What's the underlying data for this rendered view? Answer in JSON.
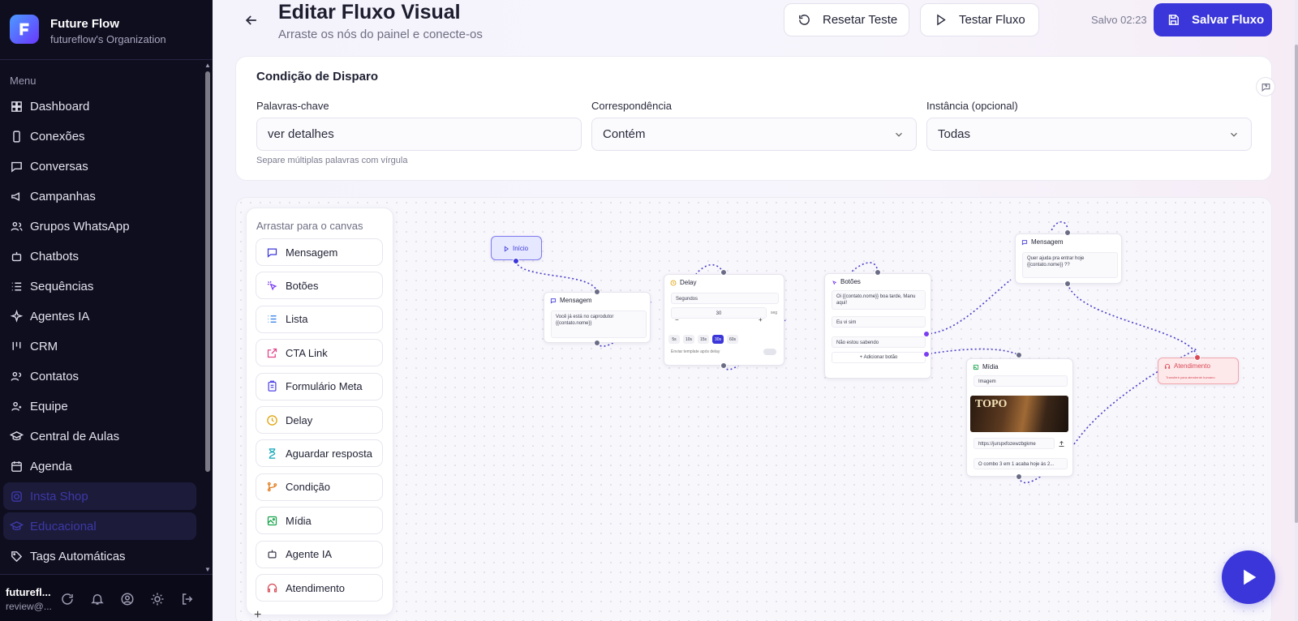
{
  "sidebar": {
    "brand_name": "Future Flow",
    "brand_org": "futureflow's Organization",
    "menu_title": "Menu",
    "items": [
      {
        "label": "Dashboard",
        "icon": "dashboard-icon"
      },
      {
        "label": "Conexões",
        "icon": "phone-icon"
      },
      {
        "label": "Conversas",
        "icon": "chat-icon"
      },
      {
        "label": "Campanhas",
        "icon": "megaphone-icon"
      },
      {
        "label": "Grupos WhatsApp",
        "icon": "users-icon"
      },
      {
        "label": "Chatbots",
        "icon": "bot-icon"
      },
      {
        "label": "Sequências",
        "icon": "list-icon"
      },
      {
        "label": "Agentes IA",
        "icon": "sparkle-icon"
      },
      {
        "label": "CRM",
        "icon": "kanban-icon"
      },
      {
        "label": "Contatos",
        "icon": "contacts-icon"
      },
      {
        "label": "Equipe",
        "icon": "team-icon"
      },
      {
        "label": "Central de Aulas",
        "icon": "graduation-icon"
      },
      {
        "label": "Agenda",
        "icon": "calendar-icon"
      },
      {
        "label": "Insta Shop",
        "icon": "instagram-icon"
      },
      {
        "label": "Educacional",
        "icon": "education-icon"
      },
      {
        "label": "Tags Automáticas",
        "icon": "tag-icon"
      }
    ],
    "user_name": "futurefl...",
    "user_email": "review@..."
  },
  "header": {
    "title": "Editar Fluxo Visual",
    "subtitle": "Arraste os nós do painel e conecte-os",
    "reset_label": "Resetar Teste",
    "test_label": "Testar Fluxo",
    "saved_text": "Salvo 02:23",
    "save_label": "Salvar Fluxo"
  },
  "trigger": {
    "title": "Condição de Disparo",
    "keywords_label": "Palavras-chave",
    "keywords_value": "ver detalhes",
    "keywords_hint": "Separe múltiplas palavras com vírgula",
    "match_label": "Correspondência",
    "match_value": "Contém",
    "instance_label": "Instância (opcional)",
    "instance_value": "Todas"
  },
  "palette": {
    "title": "Arrastar para o canvas",
    "items": [
      {
        "label": "Mensagem",
        "icon": "message-icon",
        "color": "#3b36d9"
      },
      {
        "label": "Botões",
        "icon": "click-icon",
        "color": "#7a3df2"
      },
      {
        "label": "Lista",
        "icon": "list-icon",
        "color": "#2c7be5"
      },
      {
        "label": "CTA Link",
        "icon": "external-link-icon",
        "color": "#e0468a"
      },
      {
        "label": "Formulário Meta",
        "icon": "clipboard-icon",
        "color": "#4f46e5"
      },
      {
        "label": "Delay",
        "icon": "clock-icon",
        "color": "#e0a000"
      },
      {
        "label": "Aguardar resposta",
        "icon": "hourglass-icon",
        "color": "#0ea5b7"
      },
      {
        "label": "Condição",
        "icon": "branch-icon",
        "color": "#e07a1a"
      },
      {
        "label": "Mídia",
        "icon": "image-icon",
        "color": "#16a34a"
      },
      {
        "label": "Agente IA",
        "icon": "bot-icon",
        "color": "#3a3b4d"
      },
      {
        "label": "Atendimento",
        "icon": "headset-icon",
        "color": "#d94b57"
      }
    ]
  },
  "nodes": {
    "start": {
      "label": "Início"
    },
    "msg1": {
      "title": "Mensagem",
      "text": "Você já está no caprodutor {{contato.nome}}"
    },
    "delay": {
      "title": "Delay",
      "unit": "Segundos",
      "value": "30",
      "unit_short": "seg",
      "presets": [
        "5s",
        "10s",
        "15s",
        "30s",
        "60s"
      ],
      "selected_preset": "30s",
      "toggle_label": "Enviar template após delay"
    },
    "buttons": {
      "title": "Botões",
      "text": "Oi {{contato.nome}} boa tarde, Manu aqui!",
      "options": [
        "Eu vi sim",
        "Não estou sabendo"
      ],
      "add_label": "Adicionar botão"
    },
    "msg2": {
      "title": "Mensagem",
      "text": "Quer ajuda pra entrar hoje {{contato.nome}} ??"
    },
    "media": {
      "title": "Mídia",
      "type": "Imagem",
      "image_text": "TOPO",
      "url": "https://jurspxfozewzbgkme",
      "caption": "O combo 3 em 1 acaba hoje às 2..."
    },
    "support": {
      "title": "Atendimento",
      "text": "Transferir para atendente humano"
    }
  },
  "colors": {
    "accent": "#3b36d9",
    "sidebar_bg": "#0f0e1f",
    "edge": "#4a3fc7",
    "support": "#d94b57"
  }
}
